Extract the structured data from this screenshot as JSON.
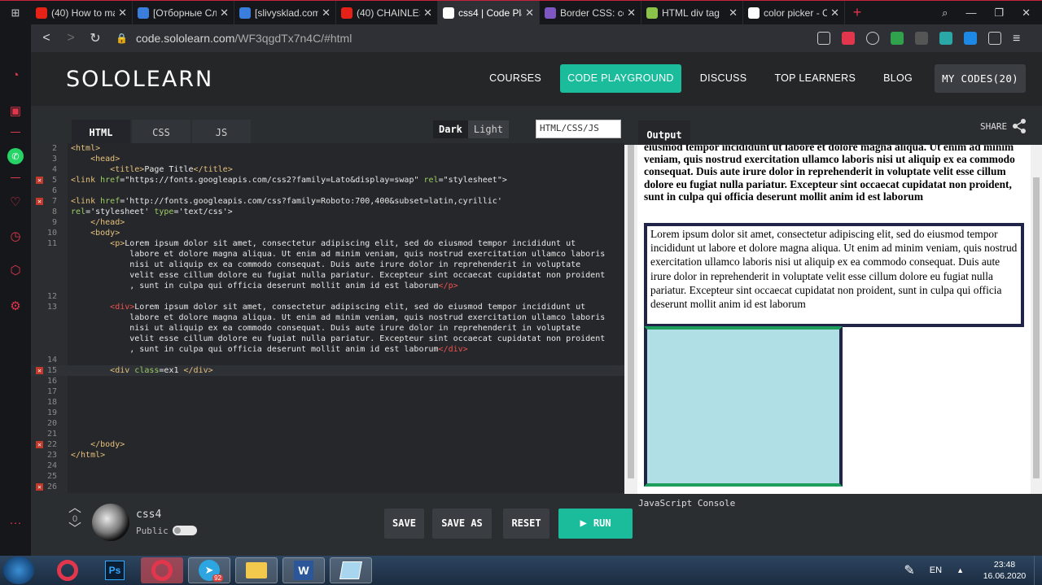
{
  "browser": {
    "tabs": [
      {
        "title": "(40) How to ma",
        "color": "#e62117"
      },
      {
        "title": "[Отборные Сл",
        "color": "#3b7ddd"
      },
      {
        "title": "[slivysklad.com",
        "color": "#3b7ddd"
      },
      {
        "title": "(40) CHAINLES:",
        "color": "#e62117"
      },
      {
        "title": "css4 | Code Pla",
        "color": "#ffffff",
        "active": true
      },
      {
        "title": "Border CSS: co",
        "color": "#7e57c2"
      },
      {
        "title": "HTML div tag",
        "color": "#8bc34a"
      },
      {
        "title": "color picker - C",
        "color": "#ffffff"
      }
    ],
    "url_host": "code.sololearn.com",
    "url_path": "/WF3qgdTx7n4C/#html"
  },
  "nav": {
    "logo": "SOLOLEARN",
    "courses": "COURSES",
    "code_playground": "CODE PLAYGROUND",
    "discuss": "DISCUSS",
    "top_learners": "TOP LEARNERS",
    "blog": "BLOG",
    "my_codes": "MY CODES(20)"
  },
  "editor": {
    "tabs": [
      "HTML",
      "CSS",
      "JS"
    ],
    "theme_dark": "Dark",
    "theme_light": "Light",
    "mode": "HTML/CSS/JS",
    "lines": [
      {
        "n": "2",
        "html": "<span class='tg'>&lt;html&gt;</span>"
      },
      {
        "n": "3",
        "html": "    <span class='tg'>&lt;head&gt;</span>"
      },
      {
        "n": "4",
        "html": "        <span class='tg'>&lt;title&gt;</span>Page Title<span class='tg'>&lt;/title&gt;</span>"
      },
      {
        "n": "5",
        "err": true,
        "html": "<span class='tg'>&lt;link</span> <span class='at'>href</span>=\"https://fonts.googleapis.com/css2?family=Lato&amp;display=swap\" <span class='at'>rel</span>=\"stylesheet\"&gt;"
      },
      {
        "n": "6",
        "html": ""
      },
      {
        "n": "7",
        "err": true,
        "html": "<span class='tg'>&lt;link</span> <span class='at'>href</span>='http://fonts.googleapis.com/css?family=Roboto:700,400&amp;subset=latin,cyrillic'"
      },
      {
        "n": "8",
        "html": "<span class='at'>rel</span>='stylesheet' <span class='at'>type</span>='text/css'&gt;"
      },
      {
        "n": "9",
        "html": "    <span class='tg'>&lt;/head&gt;</span>"
      },
      {
        "n": "10",
        "html": "    <span class='tg'>&lt;body&gt;</span>"
      },
      {
        "n": "11",
        "html": "        <span class='tg'>&lt;p&gt;</span>Lorem ipsum dolor sit amet, consectetur adipiscing elit, sed do eiusmod tempor incididunt ut"
      },
      {
        "n": "",
        "html": "            labore et dolore magna aliqua. Ut enim ad minim veniam, quis nostrud exercitation ullamco laboris"
      },
      {
        "n": "",
        "html": "            nisi ut aliquip ex ea commodo consequat. Duis aute irure dolor in reprehenderit in voluptate"
      },
      {
        "n": "",
        "html": "            velit esse cillum dolore eu fugiat nulla pariatur. Excepteur sint occaecat cupidatat non proident"
      },
      {
        "n": "",
        "html": "            , sunt in culpa qui officia deserunt mollit anim id est laborum<span class='tgr'>&lt;/p&gt;</span>"
      },
      {
        "n": "12",
        "html": ""
      },
      {
        "n": "13",
        "html": "        <span class='tgr'>&lt;div&gt;</span>Lorem ipsum dolor sit amet, consectetur adipiscing elit, sed do eiusmod tempor incididunt ut"
      },
      {
        "n": "",
        "html": "            labore et dolore magna aliqua. Ut enim ad minim veniam, quis nostrud exercitation ullamco laboris"
      },
      {
        "n": "",
        "html": "            nisi ut aliquip ex ea commodo consequat. Duis aute irure dolor in reprehenderit in voluptate"
      },
      {
        "n": "",
        "html": "            velit esse cillum dolore eu fugiat nulla pariatur. Excepteur sint occaecat cupidatat non proident"
      },
      {
        "n": "",
        "html": "            , sunt in culpa qui officia deserunt mollit anim id est laborum<span class='tgr'>&lt;/div&gt;</span>"
      },
      {
        "n": "14",
        "html": ""
      },
      {
        "n": "15",
        "err": true,
        "active": true,
        "html": "        <span class='tg'>&lt;div</span> <span class='at'>class</span>=ex1 <span class='tg'>&lt;/div&gt;</span>"
      },
      {
        "n": "16",
        "html": ""
      },
      {
        "n": "17",
        "html": ""
      },
      {
        "n": "18",
        "html": ""
      },
      {
        "n": "19",
        "html": ""
      },
      {
        "n": "20",
        "html": ""
      },
      {
        "n": "21",
        "html": ""
      },
      {
        "n": "22",
        "err": true,
        "html": "    <span class='tg'>&lt;/body&gt;</span>"
      },
      {
        "n": "23",
        "html": "<span class='tg'>&lt;/html&gt;</span>"
      },
      {
        "n": "24",
        "html": ""
      },
      {
        "n": "25",
        "html": ""
      },
      {
        "n": "26",
        "err": true,
        "html": ""
      }
    ],
    "vote_count": "0",
    "code_name": "css4",
    "public_label": "Public",
    "save": "SAVE",
    "save_as": "SAVE AS",
    "reset": "RESET",
    "run": "RUN"
  },
  "output": {
    "tab_label": "Output",
    "share_label": "SHARE",
    "bold_text": "eiusmod tempor incididunt ut labore et dolore magna aliqua. Ut enim ad minim veniam, quis nostrud exercitation ullamco laboris nisi ut aliquip ex ea commodo consequat. Duis aute irure dolor in reprehenderit in voluptate velit esse cillum dolore eu fugiat nulla pariatur. Excepteur sint occaecat cupidatat non proident, sunt in culpa qui officia deserunt mollit anim id est laborum",
    "div_text": "Lorem ipsum dolor sit amet, consectetur adipiscing elit, sed do eiusmod tempor incididunt ut labore et dolore magna aliqua. Ut enim ad minim veniam, quis nostrud exercitation ullamco laboris nisi ut aliquip ex ea commodo consequat. Duis aute irure dolor in reprehenderit in voluptate velit esse cillum dolore eu fugiat nulla pariatur. Excepteur sint occaecat cupidatat non proident, sunt in culpa qui officia deserunt mollit anim id est laborum",
    "console_label": "JavaScript Console"
  },
  "taskbar": {
    "lang": "EN",
    "time": "23:48",
    "date": "16.06.2020",
    "telegram_badge": "92"
  }
}
